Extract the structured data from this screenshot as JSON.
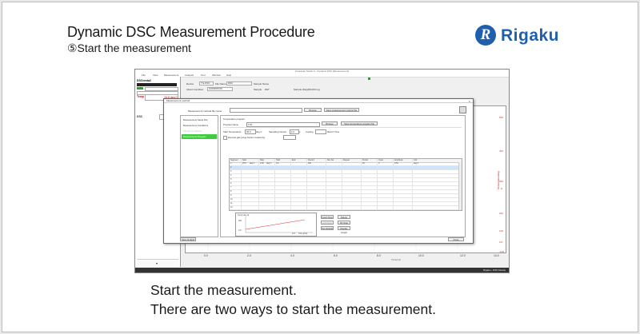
{
  "slide": {
    "title": "Dynamic DSC Measurement Procedure",
    "subtitle": "⑤Start the measurement",
    "logo_text": "Rigaku",
    "caption_line1": "Start the measurement.",
    "caption_line2": "There are two ways to start the measurement."
  },
  "app": {
    "window_title": "SmartLab Studio II - Dynamic DSC [Measurement]",
    "menu": [
      "File",
      "View",
      "Measurement",
      "Analysis",
      "Tool",
      "Window",
      "Help"
    ],
    "toolbar": {
      "device_label": "Device",
      "device_value": "TG-DSC",
      "file_name_label": "File Name",
      "file_name_value": "DSC",
      "sample_name_label": "Sample Name",
      "about_condition_label": "About Condition",
      "about_condition_value": "CONDITION",
      "sample_label": "Sample",
      "sample_value": "PET",
      "sample_weight_label": "Sample Weight",
      "sample_weight_value": "5.000 mg"
    },
    "left_panel": {
      "title": "DSCvesta2",
      "temp_label": "Temp",
      "temp_value": "24.6 deg C",
      "dsc_label": "DSC",
      "dsc_value": "0.7mW"
    },
    "status_text": "Rigaku - DSC Ready"
  },
  "plot": {
    "x_ticks": [
      "0.0",
      "2.0",
      "4.0",
      "6.0",
      "8.0",
      "10.0",
      "12.0",
      "14.0"
    ],
    "x_label": "Time/min",
    "y_ticks": [
      "500",
      "400",
      "300",
      "200",
      "100",
      "0.0",
      "-100"
    ],
    "y_label": "Temperature/deg C"
  },
  "dialog": {
    "title": "Measurement method",
    "method_file_label": "Measurement method file name",
    "browse_label": "Browse",
    "save_file_label": "Save measurement method file",
    "left_items": [
      "Measurement Setup File",
      "Measurement Conditions",
      "Sample Conditions",
      "Measurement Program"
    ],
    "selected_index": 3,
    "temp_program_label": "Temperature program",
    "program_name_label": "Program Name",
    "program_name_value": "T.P1",
    "program_browse_label": "Browse",
    "save_program_label": "Save temperature program file",
    "start_temp_label": "Start Temperature",
    "start_temp_value": "25.0",
    "start_temp_unit": "deg C",
    "sampling_label": "Sampling Interval",
    "sampling_value": "1.0",
    "sampling_unit": "s",
    "cooling_label": "Cooling",
    "wait_label": "Return Time",
    "purge_label": "Execute gas purge before measuring",
    "columns": [
      "Segment",
      "Start",
      "Rate",
      "Hold",
      "End",
      "Record",
      "Run No.",
      "Repeat",
      "Period",
      "Cycle",
      "Amplitude",
      "Unit"
    ],
    "rows": [
      {
        "seg": "1",
        "start": "25.0",
        "start_unit": "deg C",
        "rate": "2.00",
        "rate_unit": "deg C",
        "hold": "0.0",
        "end": "300",
        "period": "60",
        "cycle": "0",
        "amp": "0.50",
        "unit": "deg C"
      },
      {
        "seg": "2"
      },
      {
        "seg": "3"
      },
      {
        "seg": "4"
      },
      {
        "seg": "5"
      },
      {
        "seg": "6"
      },
      {
        "seg": "7"
      },
      {
        "seg": "8"
      },
      {
        "seg": "9"
      },
      {
        "seg": "10"
      },
      {
        "seg": "11"
      },
      {
        "seg": "12"
      }
    ],
    "graph_ylabel": "Temp [deg C]",
    "graph_xlabel": "Time [min]",
    "graph_y_top": "300",
    "graph_y_bottom": "0.0",
    "graph_x_right": "137",
    "side_buttons": [
      "Insert Row",
      "Delete Row",
      "Add Row",
      "All Clear",
      "Set Default",
      "Display Graph"
    ],
    "save_default_label": "Save Default",
    "close_label": "Close"
  }
}
